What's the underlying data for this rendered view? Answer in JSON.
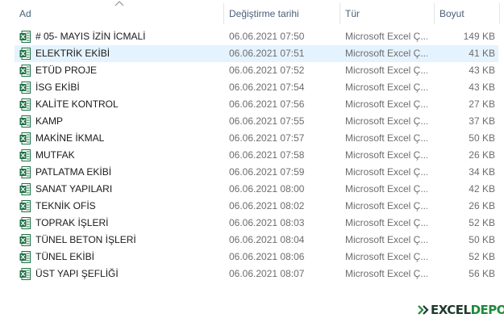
{
  "columns": {
    "name": "Ad",
    "date": "Değiştirme tarihi",
    "type": "Tür",
    "size": "Boyut"
  },
  "icon": "excel-file-icon",
  "files": [
    {
      "name": "# 05- MAYIS İZİN İCMALİ",
      "date": "06.06.2021 07:50",
      "type": "Microsoft Excel Ç...",
      "size": "149 KB"
    },
    {
      "name": "ELEKTRİK EKİBİ",
      "date": "06.06.2021 07:51",
      "type": "Microsoft Excel Ç...",
      "size": "41 KB"
    },
    {
      "name": "ETÜD PROJE",
      "date": "06.06.2021 07:52",
      "type": "Microsoft Excel Ç...",
      "size": "43 KB"
    },
    {
      "name": "İSG EKİBİ",
      "date": "06.06.2021 07:54",
      "type": "Microsoft Excel Ç...",
      "size": "43 KB"
    },
    {
      "name": "KALİTE KONTROL",
      "date": "06.06.2021 07:56",
      "type": "Microsoft Excel Ç...",
      "size": "27 KB"
    },
    {
      "name": "KAMP",
      "date": "06.06.2021 07:55",
      "type": "Microsoft Excel Ç...",
      "size": "37 KB"
    },
    {
      "name": "MAKİNE İKMAL",
      "date": "06.06.2021 07:57",
      "type": "Microsoft Excel Ç...",
      "size": "50 KB"
    },
    {
      "name": "MUTFAK",
      "date": "06.06.2021 07:58",
      "type": "Microsoft Excel Ç...",
      "size": "26 KB"
    },
    {
      "name": "PATLATMA EKİBİ",
      "date": "06.06.2021 07:59",
      "type": "Microsoft Excel Ç...",
      "size": "34 KB"
    },
    {
      "name": "SANAT YAPILARI",
      "date": "06.06.2021 08:00",
      "type": "Microsoft Excel Ç...",
      "size": "42 KB"
    },
    {
      "name": "TEKNİK OFİS",
      "date": "06.06.2021 08:02",
      "type": "Microsoft Excel Ç...",
      "size": "26 KB"
    },
    {
      "name": "TOPRAK İŞLERİ",
      "date": "06.06.2021 08:03",
      "type": "Microsoft Excel Ç...",
      "size": "52 KB"
    },
    {
      "name": "TÜNEL BETON İŞLERİ",
      "date": "06.06.2021 08:04",
      "type": "Microsoft Excel Ç...",
      "size": "50 KB"
    },
    {
      "name": "TÜNEL EKİBİ",
      "date": "06.06.2021 08:06",
      "type": "Microsoft Excel Ç...",
      "size": "52 KB"
    },
    {
      "name": "ÜST YAPI ŞEFLİĞİ",
      "date": "06.06.2021 08:07",
      "type": "Microsoft Excel Ç...",
      "size": "56 KB"
    }
  ],
  "selected_index": 1,
  "watermark": {
    "part1": "EXCEL",
    "part2": "DEPO"
  },
  "colors": {
    "selection": "#e5f3ff",
    "excel_green": "#1e7145",
    "header_text": "#4c607a"
  }
}
